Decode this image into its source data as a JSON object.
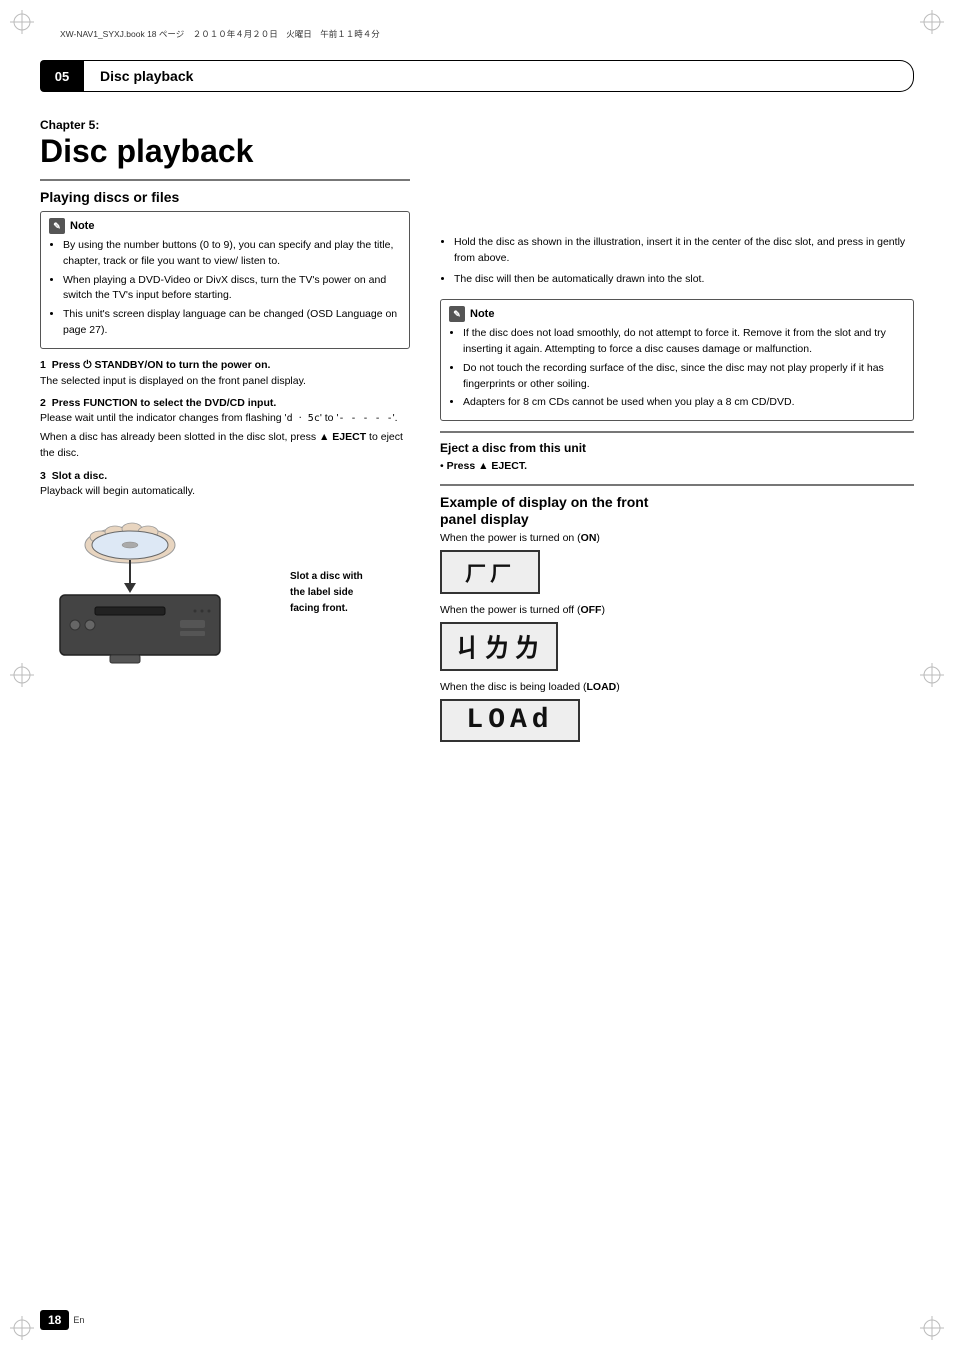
{
  "file_note": "XW-NAV1_SYXJ.book  18 ページ　２０１０年４月２０日　火曜日　午前１１時４分",
  "header": {
    "chapter_number": "05",
    "title": "Disc playback"
  },
  "chapter": {
    "label": "Chapter 5:",
    "title": "Disc playback"
  },
  "left_column": {
    "section_title": "Playing discs or files",
    "note1": {
      "header": "Note",
      "items": [
        "By using the number buttons (0 to 9), you can specify and play the title, chapter, track or file you want to view/ listen to.",
        "When playing a DVD-Video or DivX discs, turn the TV's power on and switch the TV's input before starting.",
        "This unit's screen display language can be changed (OSD Language on page 27)."
      ]
    },
    "step1": {
      "number": "1",
      "heading": "Press  STANDBY/ON to turn the power on.",
      "body": "The selected input is displayed on the front panel display."
    },
    "step2": {
      "number": "2",
      "heading": "Press FUNCTION to select the DVD/CD input.",
      "body1": "Please wait until the indicator changes from flashing ‘ d ‧ 5c ’ to ‘ - - - - - ’.",
      "body2": "When a disc has already been slotted in the disc slot, press ▲ EJECT to eject the disc."
    },
    "step3": {
      "number": "3",
      "heading": "Slot a disc.",
      "body": "Playback will begin automatically."
    },
    "disc_label": "Slot a disc with\nthe label side\nfacing front."
  },
  "right_column": {
    "bullets": [
      "Hold the disc as shown in the illustration, insert it in the center of the disc slot, and press in gently from above.",
      "The disc will then be automatically drawn into the slot."
    ],
    "note2": {
      "header": "Note",
      "items": [
        "If the disc does not load smoothly, do not attempt to force it. Remove it from the slot and try inserting it again. Attempting to force a disc causes damage or malfunction.",
        "Do not touch the recording surface of the disc, since the disc may not play properly if it has fingerprints or other soiling.",
        "Adapters for 8 cm CDs cannot be used when you play a 8 cm CD/DVD."
      ]
    },
    "eject": {
      "title": "Eject a disc from this unit",
      "text": "Press ▲ EJECT."
    },
    "display_section": {
      "title": "Example of display on the front panel display",
      "on_label": "When the power is turned on (",
      "on_bold": "ON",
      "on_end": ")",
      "on_display": "On",
      "off_label": "When the power is turned off (",
      "off_bold": "OFF",
      "off_end": ")",
      "off_display": "OFF",
      "load_label": "When the disc is being loaded (",
      "load_bold": "LOAD",
      "load_end": ")",
      "load_display": "LOAd"
    }
  },
  "footer": {
    "page_number": "18",
    "lang": "En"
  }
}
